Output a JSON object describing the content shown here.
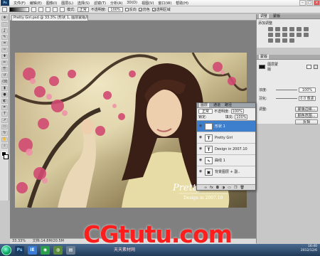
{
  "app": {
    "logo": "Ps"
  },
  "menu": [
    "文件(F)",
    "编辑(E)",
    "图像(I)",
    "图层(L)",
    "选择(S)",
    "滤镜(T)",
    "分析(A)",
    "3D(D)",
    "视图(V)",
    "窗口(W)",
    "帮助(H)"
  ],
  "options": {
    "mode_label": "模式:",
    "mode_value": "正常",
    "opacity_label": "不透明度:",
    "opacity_value": "100%",
    "reverse": "反向",
    "dither": "仿色",
    "transparency": "透明区域"
  },
  "document": {
    "tab_title": "Pretty Girl.psd @ 33.3% (形状 1, 图层蒙版/8) *",
    "zoom": "33.33%",
    "doc_size": "文档:14.8M/20.5M"
  },
  "photo": {
    "title_text": "Pretty Girl",
    "subtitle_text": "Design in 2007.10"
  },
  "right_top_panel": {
    "tabs": [
      "调整",
      "蒙版"
    ],
    "header": "添加调整"
  },
  "masks_panel": {
    "tabs": [
      "蒙版"
    ],
    "mask_label": "图层蒙版",
    "density_label": "浓度:",
    "density_value": "100%",
    "feather_label": "羽化:",
    "feather_value": "0.0 像素",
    "refine_label": "调整:",
    "buttons": [
      "蒙版边缘...",
      "颜色范围...",
      "反相"
    ]
  },
  "layers_panel": {
    "tabs": [
      "图层",
      "通道",
      "路径"
    ],
    "kind_value": "正常",
    "opacity_label": "不透明度:",
    "opacity_value": "100%",
    "lock_label": "锁定:",
    "fill_label": "填充:",
    "fill_value": "100%",
    "layers": [
      {
        "name": "形状 1",
        "thumb": "◆",
        "selected": true
      },
      {
        "name": "Pretty Girl",
        "thumb": "T",
        "selected": false
      },
      {
        "name": "Design in 2007.10",
        "thumb": "T",
        "selected": false
      },
      {
        "name": "曲线 1",
        "thumb": "∿",
        "selected": false
      },
      {
        "name": "背景图层 + 副..",
        "thumb": "▣",
        "selected": false
      }
    ]
  },
  "taskbar": {
    "apps": [
      "Ps",
      "IE",
      "",
      "",
      ""
    ],
    "time": "16:40",
    "date": "2012/12/6"
  },
  "watermark": {
    "main": "CGtutu.com",
    "sub": "天天素材网"
  },
  "colors": {
    "accent": "#3d7fcc",
    "watermark": "#ff1e1e"
  }
}
